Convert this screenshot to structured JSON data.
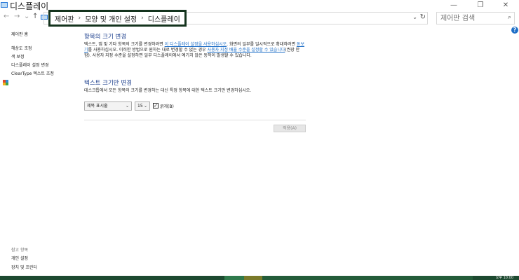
{
  "window": {
    "title": "디스플레이",
    "minimize": "—",
    "maximize": "❐",
    "close": "✕"
  },
  "nav": {
    "back": "←",
    "forward": "→",
    "recent": "⌄",
    "up": "↑",
    "breadcrumb": [
      "제어판",
      "모양 및 개인 설정",
      "디스플레이"
    ],
    "separator": "›",
    "address_dropdown": "⌄",
    "refresh": "↻",
    "search_placeholder": "제어판 검색",
    "search_icon": "⌕"
  },
  "help": {
    "label": "?"
  },
  "sidebar": {
    "home": "제어판 홈",
    "links": [
      "해상도 조정",
      "색 보정",
      "디스플레이 설정 변경",
      "ClearType 텍스트 조정"
    ],
    "see_also_heading": "참고 항목",
    "see_also": [
      "개인 설정",
      "장치 및 프린터"
    ]
  },
  "main": {
    "section1_title": "항목의 크기 변경",
    "section1_p1": "텍스트, 앱 및 기타 항목의 크기를 변경하려면 ",
    "section1_link1": "이 디스플레이 설정을 사용하십시오",
    "section1_p2": ". 화면의 일부를 일시적으로 확대하려면 ",
    "section1_link2": "돋보기",
    "section1_p3": "를 사용하십시오. 이러한 방법으로 원하는 대로 변경할 수 없는 경우 ",
    "section1_link3": "사용자 지정 배율 수준을 설정할 수 있습니다",
    "section1_p4": "(권장 안 함). 사용자 지정 수준을 설정하면 일부 디스플레이에서 예기치 않은 동작이 발생할 수 있습니다.",
    "section2_title": "텍스트 크기만 변경",
    "section2_desc": "데스크톱에서 모든 항목의 크기를 변경하는 대신 특정 항목에 대한 텍스트 크기만 변경하십시오.",
    "item_select": "제목 표시줄",
    "size_select": "15",
    "bold_label": "굵게(B)",
    "bold_checked": "✓",
    "apply_label": "적용(A)"
  },
  "taskbar": {
    "clock": "오후 10:00",
    "colors": [
      "#1d4a30",
      "#2f7a4c",
      "#7a7a2a",
      "#245c3a"
    ]
  }
}
